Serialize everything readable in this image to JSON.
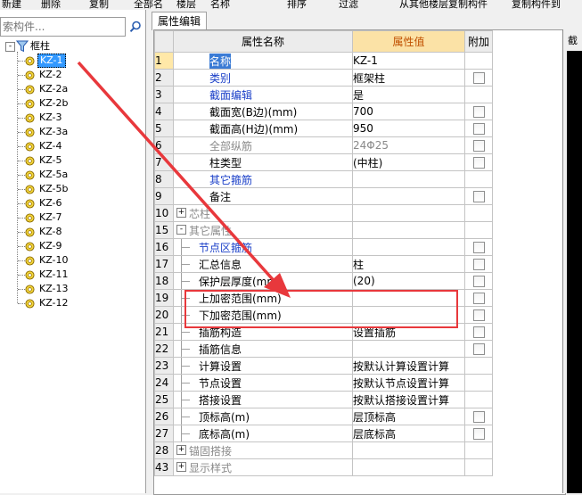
{
  "toolbar": {
    "items": [
      "新建",
      "删除",
      "复制",
      "全部名",
      "楼层",
      "名称",
      "排序",
      "过滤",
      "从其他楼层复制构件",
      "复制构件到"
    ]
  },
  "search": {
    "placeholder": "索构件..."
  },
  "tree": {
    "root": "框柱",
    "items": [
      "KZ-1",
      "KZ-2",
      "KZ-2a",
      "KZ-2b",
      "KZ-3",
      "KZ-3a",
      "KZ-4",
      "KZ-5",
      "KZ-5a",
      "KZ-5b",
      "KZ-6",
      "KZ-7",
      "KZ-8",
      "KZ-9",
      "KZ-10",
      "KZ-11",
      "KZ-13",
      "KZ-12"
    ],
    "selected": "KZ-1"
  },
  "tab": {
    "label": "属性编辑"
  },
  "grid": {
    "headers": {
      "name": "属性名称",
      "value": "属性值",
      "extra": "附加"
    },
    "rows": [
      {
        "num": "1",
        "name": "名称",
        "value": "KZ-1",
        "check": false,
        "style": "selfirst",
        "level": 0
      },
      {
        "num": "2",
        "name": "类别",
        "value": "框架柱",
        "check": true,
        "style": "blue",
        "level": 0
      },
      {
        "num": "3",
        "name": "截面编辑",
        "value": "是",
        "check": false,
        "style": "blue",
        "level": 0
      },
      {
        "num": "4",
        "name": "截面宽(B边)(mm)",
        "value": "700",
        "check": true,
        "style": "",
        "level": 0
      },
      {
        "num": "5",
        "name": "截面高(H边)(mm)",
        "value": "950",
        "check": true,
        "style": "",
        "level": 0
      },
      {
        "num": "6",
        "name": "全部纵筋",
        "value": "24Φ25",
        "check": true,
        "style": "gray",
        "level": 0
      },
      {
        "num": "7",
        "name": "柱类型",
        "value": "(中柱)",
        "check": true,
        "style": "",
        "level": 0
      },
      {
        "num": "8",
        "name": "其它箍筋",
        "value": "",
        "check": false,
        "style": "blue",
        "level": 0
      },
      {
        "num": "9",
        "name": "备注",
        "value": "",
        "check": true,
        "style": "",
        "level": 0
      },
      {
        "num": "10",
        "name": "芯柱",
        "value": "",
        "check": false,
        "style": "gray",
        "level": 0,
        "expand": "+"
      },
      {
        "num": "15",
        "name": "其它属性",
        "value": "",
        "check": false,
        "style": "gray",
        "level": 0,
        "expand": "-"
      },
      {
        "num": "16",
        "name": "节点区箍筋",
        "value": "",
        "check": true,
        "style": "blue",
        "level": 1
      },
      {
        "num": "17",
        "name": "汇总信息",
        "value": "柱",
        "check": true,
        "style": "",
        "level": 1
      },
      {
        "num": "18",
        "name": "保护层厚度(mm)",
        "value": "(20)",
        "check": true,
        "style": "",
        "level": 1
      },
      {
        "num": "19",
        "name": "上加密范围(mm)",
        "value": "",
        "check": true,
        "style": "",
        "level": 1
      },
      {
        "num": "20",
        "name": "下加密范围(mm)",
        "value": "",
        "check": true,
        "style": "",
        "level": 1
      },
      {
        "num": "21",
        "name": "插筋构造",
        "value": "设置插筋",
        "check": true,
        "style": "",
        "level": 1
      },
      {
        "num": "22",
        "name": "插筋信息",
        "value": "",
        "check": true,
        "style": "",
        "level": 1
      },
      {
        "num": "23",
        "name": "计算设置",
        "value": "按默认计算设置计算",
        "check": false,
        "style": "",
        "level": 1
      },
      {
        "num": "24",
        "name": "节点设置",
        "value": "按默认节点设置计算",
        "check": false,
        "style": "",
        "level": 1
      },
      {
        "num": "25",
        "name": "搭接设置",
        "value": "按默认搭接设置计算",
        "check": false,
        "style": "",
        "level": 1
      },
      {
        "num": "26",
        "name": "顶标高(m)",
        "value": "层顶标高",
        "check": true,
        "style": "",
        "level": 1
      },
      {
        "num": "27",
        "name": "底标高(m)",
        "value": "层底标高",
        "check": true,
        "style": "",
        "level": 1
      },
      {
        "num": "28",
        "name": "锚固搭接",
        "value": "",
        "check": false,
        "style": "gray",
        "level": 0,
        "expand": "+"
      },
      {
        "num": "43",
        "name": "显示样式",
        "value": "",
        "check": false,
        "style": "gray",
        "level": 0,
        "expand": "+"
      }
    ]
  },
  "preview": {
    "label": "截"
  },
  "colors": {
    "arrow": "#e8383c",
    "highlight": "#e8383c",
    "selection": "#3399ff"
  },
  "icons": {
    "search": "magnifier-icon",
    "root": "filter-funnel-icon",
    "item": "gear-component-icon"
  }
}
